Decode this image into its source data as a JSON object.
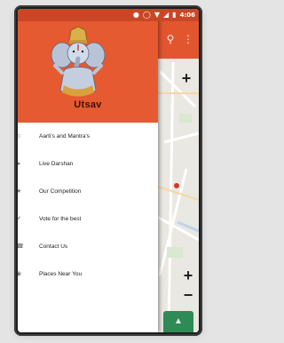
{
  "statusbar": {
    "time": "4:06",
    "icons": [
      "alarm-icon",
      "sync-icon",
      "wifi-icon",
      "signal-icon",
      "battery-icon"
    ]
  },
  "colors": {
    "accent": "#e55a30",
    "status_bar": "#c94726",
    "fab": "#2e8b55"
  },
  "drawer": {
    "app_name": "Utsav",
    "logo": "ganesha-logo",
    "items": [
      {
        "label": "Aarti's and Mantra's",
        "icon": "music-icon"
      },
      {
        "label": "Live Darshan",
        "icon": "video-icon"
      },
      {
        "label": "Our Competition",
        "icon": "trophy-icon"
      },
      {
        "label": "Vote  for the best",
        "icon": "thumbs-up-icon"
      },
      {
        "label": "Contact Us",
        "icon": "phone-icon"
      },
      {
        "label": "Places Near You",
        "icon": "location-icon"
      }
    ]
  },
  "map": {
    "zoom_in": "+",
    "zoom_out": "−",
    "toolbar_icons": [
      "search-icon",
      "more-vert-icon"
    ],
    "fab_icon": "directions-icon"
  }
}
